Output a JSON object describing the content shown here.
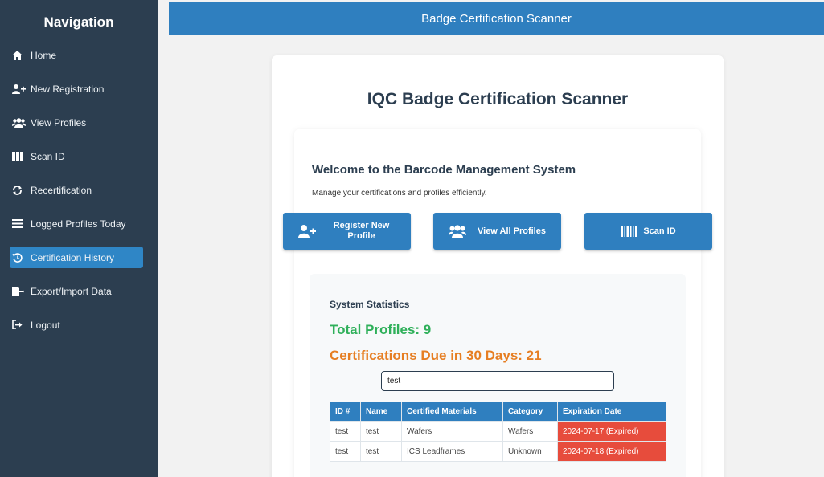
{
  "sidebar": {
    "title": "Navigation",
    "items": [
      {
        "label": "Home",
        "icon": "home-icon"
      },
      {
        "label": "New Registration",
        "icon": "user-plus-icon"
      },
      {
        "label": "View Profiles",
        "icon": "users-icon"
      },
      {
        "label": "Scan ID",
        "icon": "barcode-icon"
      },
      {
        "label": "Recertification",
        "icon": "sync-icon"
      },
      {
        "label": "Logged Profiles Today",
        "icon": "list-icon"
      },
      {
        "label": "Certification History",
        "icon": "history-icon",
        "active": true
      },
      {
        "label": "Export/Import Data",
        "icon": "file-export-icon"
      },
      {
        "label": "Logout",
        "icon": "sign-out-icon"
      }
    ]
  },
  "header": {
    "title": "Badge Certification Scanner"
  },
  "main": {
    "title": "IQC Badge Certification Scanner",
    "welcome": "Welcome to the Barcode Management System",
    "subtext": "Manage your certifications and profiles efficiently.",
    "buttons": [
      {
        "label": "Register New Profile",
        "icon": "user-plus-icon"
      },
      {
        "label": "View All Profiles",
        "icon": "users-icon"
      },
      {
        "label": "Scan ID",
        "icon": "barcode-icon"
      }
    ]
  },
  "stats": {
    "title": "System Statistics",
    "total": "Total Profiles: 9",
    "due": "Certifications Due in 30 Days: 21",
    "search_value": "test",
    "columns": [
      "ID #",
      "Name",
      "Certified Materials",
      "Category",
      "Expiration Date"
    ],
    "rows": [
      [
        "test",
        "test",
        "Wafers",
        "Wafers",
        "2024-07-17 (Expired)"
      ],
      [
        "test",
        "test",
        "ICS Leadframes",
        "Unknown",
        "2024-07-18 (Expired)"
      ]
    ]
  },
  "colors": {
    "sidebar": "#2c3e50",
    "primary": "#2f7fbf",
    "success": "#2fb05a",
    "warning": "#e67e22",
    "danger": "#e74c3c"
  }
}
